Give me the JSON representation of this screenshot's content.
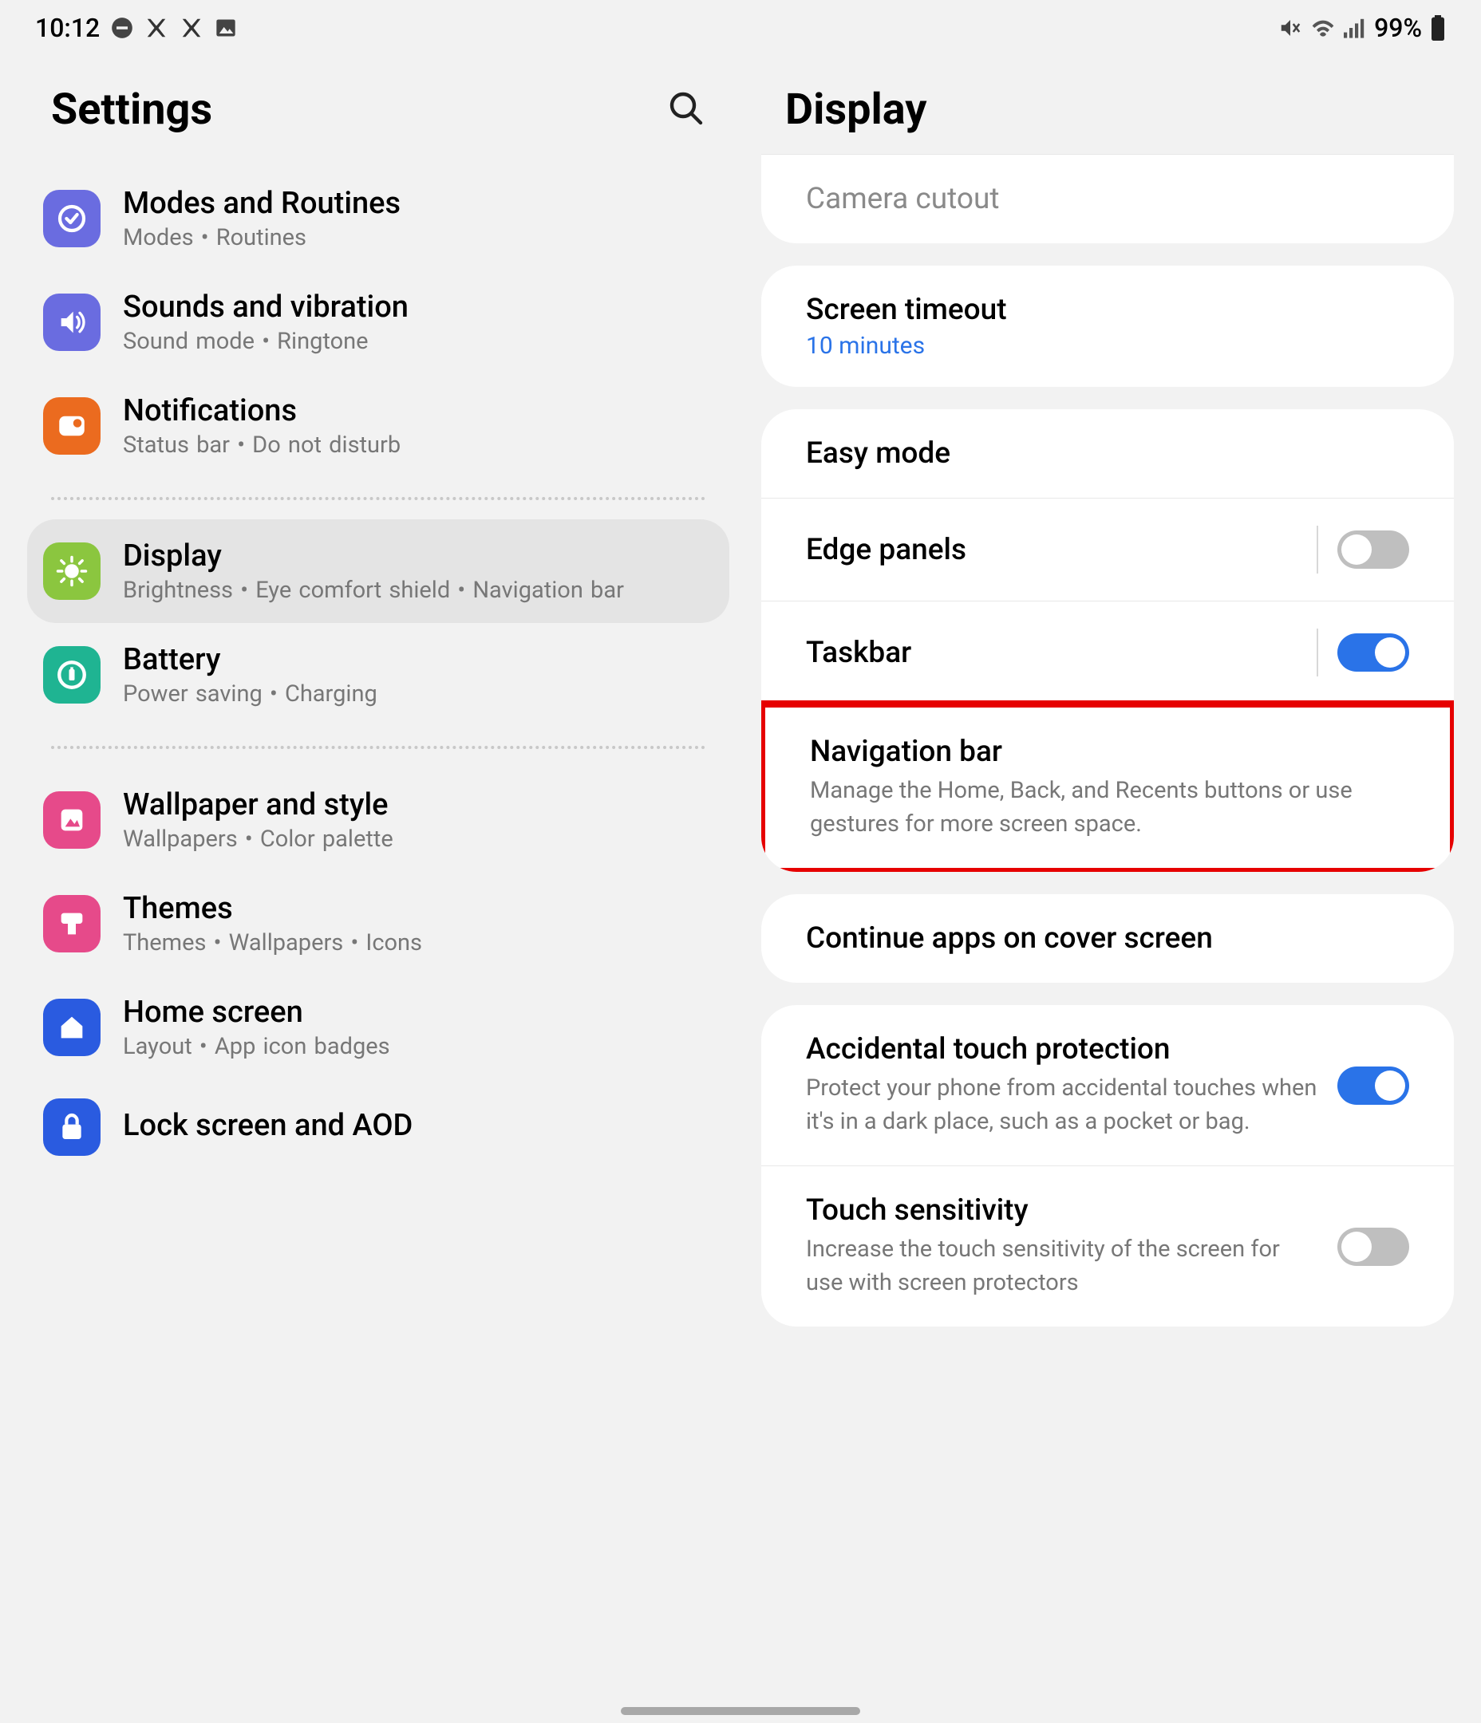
{
  "status": {
    "time": "10:12",
    "battery": "99%"
  },
  "left": {
    "title": "Settings",
    "items": [
      {
        "icon": "routines",
        "color": "#6a6ce0",
        "title": "Modes and Routines",
        "subtitle": "Modes  •  Routines"
      },
      {
        "icon": "sounds",
        "color": "#6a6ce0",
        "title": "Sounds and vibration",
        "subtitle": "Sound mode  •  Ringtone"
      },
      {
        "icon": "notifications",
        "color": "#eb6b1f",
        "title": "Notifications",
        "subtitle": "Status bar  •  Do not disturb"
      }
    ],
    "items2": [
      {
        "icon": "display",
        "color": "#8bc63f",
        "title": "Display",
        "subtitle": "Brightness  •  Eye comfort shield  •  Navigation bar",
        "selected": true
      },
      {
        "icon": "battery",
        "color": "#1fb492",
        "title": "Battery",
        "subtitle": "Power saving  •  Charging"
      }
    ],
    "items3": [
      {
        "icon": "wallpaper",
        "color": "#e64a8a",
        "title": "Wallpaper and style",
        "subtitle": "Wallpapers  •  Color palette"
      },
      {
        "icon": "themes",
        "color": "#e64a8a",
        "title": "Themes",
        "subtitle": "Themes  •  Wallpapers  •  Icons"
      },
      {
        "icon": "homescreen",
        "color": "#2a5be0",
        "title": "Home screen",
        "subtitle": "Layout  •  App icon badges"
      },
      {
        "icon": "lockscreen",
        "color": "#2a5be0",
        "title": "Lock screen and AOD",
        "subtitle": ""
      }
    ]
  },
  "right": {
    "title": "Display",
    "card1": {
      "camera_cutout": "Camera cutout"
    },
    "card2": {
      "screen_timeout": "Screen timeout",
      "timeout_value": "10 minutes"
    },
    "card3": {
      "easy_mode": "Easy mode",
      "edge_panels": "Edge panels",
      "taskbar": "Taskbar",
      "nav_bar": "Navigation bar",
      "nav_bar_desc": "Manage the Home, Back, and Recents buttons or use gestures for more screen space."
    },
    "card4": {
      "continue_apps": "Continue apps on cover screen"
    },
    "card5": {
      "accidental": "Accidental touch protection",
      "accidental_desc": "Protect your phone from accidental touches when it's in a dark place, such as a pocket or bag.",
      "touch_sens": "Touch sensitivity",
      "touch_sens_desc": "Increase the touch sensitivity of the screen for use with screen protectors"
    }
  }
}
